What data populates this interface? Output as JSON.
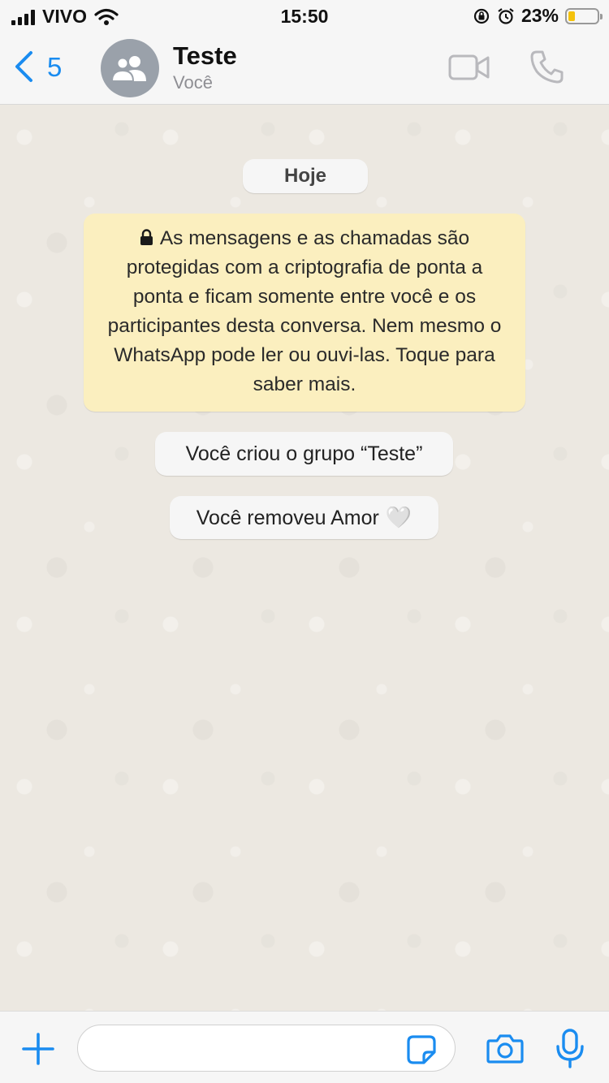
{
  "status_bar": {
    "carrier": "VIVO",
    "time": "15:50",
    "battery_percent": "23%",
    "battery_level": 0.23,
    "battery_color": "#f4c20d"
  },
  "header": {
    "back_count": "5",
    "title": "Teste",
    "subtitle": "Você",
    "icons": [
      "chevron-left-icon",
      "group-avatar-icon",
      "video-call-icon",
      "phone-icon"
    ],
    "accent_color": "#1a8cf0"
  },
  "chat": {
    "date_label": "Hoje",
    "encryption_notice": "As mensagens e as chamadas são protegidas com a criptografia de ponta a ponta e ficam somente entre você e os participantes desta conversa. Nem mesmo o WhatsApp pode ler ou ouvi-las. Toque para saber mais.",
    "notice_color": "#fbefbf",
    "system_messages": [
      {
        "text": "Você criou o grupo “Teste”"
      },
      {
        "text": "Você removeu Amor",
        "emoji": "🤍"
      }
    ]
  },
  "composer": {
    "input_value": "",
    "icons": [
      "plus-icon",
      "sticker-icon",
      "camera-icon",
      "microphone-icon"
    ]
  }
}
